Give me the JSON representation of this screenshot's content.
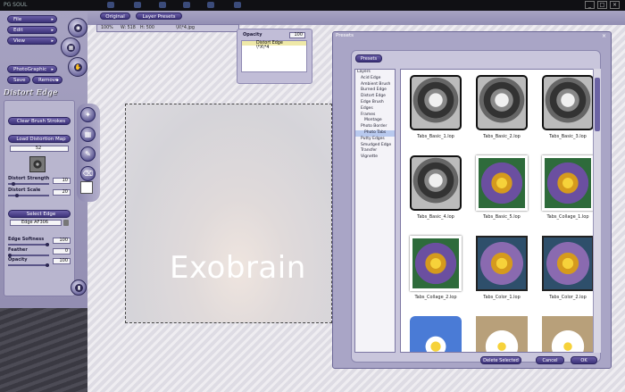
{
  "titlebar": {
    "app_logo": "PG SOUL"
  },
  "menu": {
    "file": "File",
    "edit": "Edit",
    "view": "View",
    "photographic": "PhotoGraphic",
    "save": "Save",
    "remove": "Remove"
  },
  "top_tabs": {
    "original": "Original",
    "layer_presets": "Layer Presets"
  },
  "status": {
    "zoom": "100%",
    "width": "W: 518",
    "height": "H: 500",
    "filename": "\\X\\*4.jpg"
  },
  "layer_panel": {
    "opacity_label": "Opacity",
    "opacity_value": "100",
    "items": [
      "Distort Edge",
      "\\*X\\*4"
    ]
  },
  "distort_edge": {
    "title": "Distort Edge",
    "clear_brush": "Clear Brush Strokes",
    "load_map": "Load Distortion Map",
    "map_value": "52",
    "strength_label": "Distort Strength",
    "strength_value": "10",
    "scale_label": "Distort Scale",
    "scale_value": "20",
    "select_edge": "Select Edge",
    "edge_value": "Edge AF306",
    "softness_label": "Edge Softness",
    "softness_value": "100",
    "feather_label": "Feather",
    "feather_value": "0",
    "opacity_label": "Opacity",
    "opacity_value": "100"
  },
  "canvas": {
    "overlay_text": "Exobrain"
  },
  "presets_dialog": {
    "title": "Presets",
    "tab": "Presets",
    "tree": [
      "Layers",
      "Acid Edge",
      "Ambient Brush",
      "Burned Edge",
      "Distort Edge",
      "Edge Brush",
      "Edges",
      "Frames",
      "Montage",
      "Photo Border",
      "Photo Tabs",
      "Putty Edges",
      "Smudged Edge",
      "Transfer",
      "Vignette"
    ],
    "thumbnails": [
      {
        "label": "Tabs_Basic_1.lop",
        "style": "bw"
      },
      {
        "label": "Tabs_Basic_2.lop",
        "style": "bw"
      },
      {
        "label": "Tabs_Basic_3.lop",
        "style": "bw"
      },
      {
        "label": "Tabs_Basic_4.lop",
        "style": "bw"
      },
      {
        "label": "Tabs_Basic_5.lop",
        "style": "flower"
      },
      {
        "label": "Tabs_Collage_1.lop",
        "style": "flower"
      },
      {
        "label": "Tabs_Collage_2.lop",
        "style": "flower"
      },
      {
        "label": "Tabs_Color_1.lop",
        "style": "col2"
      },
      {
        "label": "Tabs_Color_2.lop",
        "style": "col2"
      },
      {
        "label": "",
        "style": "blue"
      },
      {
        "label": "",
        "style": "white"
      },
      {
        "label": "",
        "style": "white"
      }
    ],
    "delete_selected": "Delete Selected",
    "cancel": "Cancel",
    "ok": "OK"
  },
  "colors": {
    "accent": "#3c3279",
    "panel": "#a7a3c2"
  }
}
